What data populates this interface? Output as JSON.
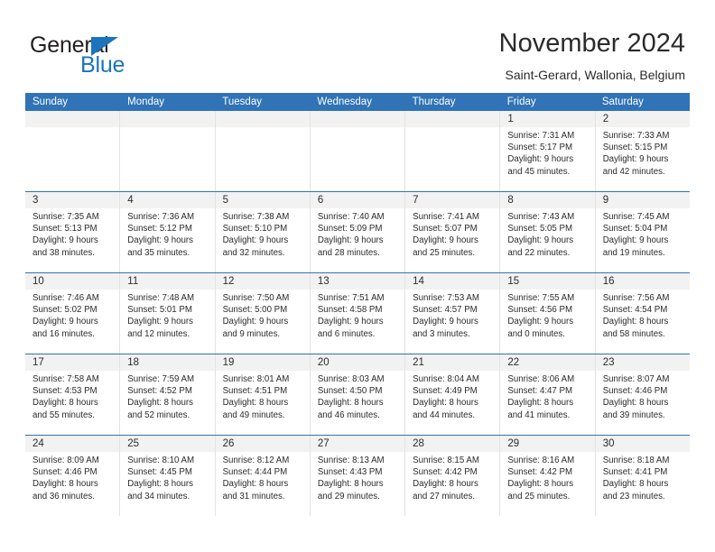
{
  "brand": {
    "name_top": "General",
    "name_bottom": "Blue",
    "accent_color": "#1b74bc"
  },
  "header": {
    "title": "November 2024",
    "subtitle": "Saint-Gerard, Wallonia, Belgium"
  },
  "theme": {
    "header_blue": "#3073b7",
    "day_band_gray": "#f2f2f2",
    "grid_line": "#e3e3e3"
  },
  "weekdays": [
    "Sunday",
    "Monday",
    "Tuesday",
    "Wednesday",
    "Thursday",
    "Friday",
    "Saturday"
  ],
  "weeks": [
    [
      {
        "day": "",
        "sunrise": "",
        "sunset": "",
        "daylight_1": "",
        "daylight_2": ""
      },
      {
        "day": "",
        "sunrise": "",
        "sunset": "",
        "daylight_1": "",
        "daylight_2": ""
      },
      {
        "day": "",
        "sunrise": "",
        "sunset": "",
        "daylight_1": "",
        "daylight_2": ""
      },
      {
        "day": "",
        "sunrise": "",
        "sunset": "",
        "daylight_1": "",
        "daylight_2": ""
      },
      {
        "day": "",
        "sunrise": "",
        "sunset": "",
        "daylight_1": "",
        "daylight_2": ""
      },
      {
        "day": "1",
        "sunrise": "Sunrise: 7:31 AM",
        "sunset": "Sunset: 5:17 PM",
        "daylight_1": "Daylight: 9 hours",
        "daylight_2": "and 45 minutes."
      },
      {
        "day": "2",
        "sunrise": "Sunrise: 7:33 AM",
        "sunset": "Sunset: 5:15 PM",
        "daylight_1": "Daylight: 9 hours",
        "daylight_2": "and 42 minutes."
      }
    ],
    [
      {
        "day": "3",
        "sunrise": "Sunrise: 7:35 AM",
        "sunset": "Sunset: 5:13 PM",
        "daylight_1": "Daylight: 9 hours",
        "daylight_2": "and 38 minutes."
      },
      {
        "day": "4",
        "sunrise": "Sunrise: 7:36 AM",
        "sunset": "Sunset: 5:12 PM",
        "daylight_1": "Daylight: 9 hours",
        "daylight_2": "and 35 minutes."
      },
      {
        "day": "5",
        "sunrise": "Sunrise: 7:38 AM",
        "sunset": "Sunset: 5:10 PM",
        "daylight_1": "Daylight: 9 hours",
        "daylight_2": "and 32 minutes."
      },
      {
        "day": "6",
        "sunrise": "Sunrise: 7:40 AM",
        "sunset": "Sunset: 5:09 PM",
        "daylight_1": "Daylight: 9 hours",
        "daylight_2": "and 28 minutes."
      },
      {
        "day": "7",
        "sunrise": "Sunrise: 7:41 AM",
        "sunset": "Sunset: 5:07 PM",
        "daylight_1": "Daylight: 9 hours",
        "daylight_2": "and 25 minutes."
      },
      {
        "day": "8",
        "sunrise": "Sunrise: 7:43 AM",
        "sunset": "Sunset: 5:05 PM",
        "daylight_1": "Daylight: 9 hours",
        "daylight_2": "and 22 minutes."
      },
      {
        "day": "9",
        "sunrise": "Sunrise: 7:45 AM",
        "sunset": "Sunset: 5:04 PM",
        "daylight_1": "Daylight: 9 hours",
        "daylight_2": "and 19 minutes."
      }
    ],
    [
      {
        "day": "10",
        "sunrise": "Sunrise: 7:46 AM",
        "sunset": "Sunset: 5:02 PM",
        "daylight_1": "Daylight: 9 hours",
        "daylight_2": "and 16 minutes."
      },
      {
        "day": "11",
        "sunrise": "Sunrise: 7:48 AM",
        "sunset": "Sunset: 5:01 PM",
        "daylight_1": "Daylight: 9 hours",
        "daylight_2": "and 12 minutes."
      },
      {
        "day": "12",
        "sunrise": "Sunrise: 7:50 AM",
        "sunset": "Sunset: 5:00 PM",
        "daylight_1": "Daylight: 9 hours",
        "daylight_2": "and 9 minutes."
      },
      {
        "day": "13",
        "sunrise": "Sunrise: 7:51 AM",
        "sunset": "Sunset: 4:58 PM",
        "daylight_1": "Daylight: 9 hours",
        "daylight_2": "and 6 minutes."
      },
      {
        "day": "14",
        "sunrise": "Sunrise: 7:53 AM",
        "sunset": "Sunset: 4:57 PM",
        "daylight_1": "Daylight: 9 hours",
        "daylight_2": "and 3 minutes."
      },
      {
        "day": "15",
        "sunrise": "Sunrise: 7:55 AM",
        "sunset": "Sunset: 4:56 PM",
        "daylight_1": "Daylight: 9 hours",
        "daylight_2": "and 0 minutes."
      },
      {
        "day": "16",
        "sunrise": "Sunrise: 7:56 AM",
        "sunset": "Sunset: 4:54 PM",
        "daylight_1": "Daylight: 8 hours",
        "daylight_2": "and 58 minutes."
      }
    ],
    [
      {
        "day": "17",
        "sunrise": "Sunrise: 7:58 AM",
        "sunset": "Sunset: 4:53 PM",
        "daylight_1": "Daylight: 8 hours",
        "daylight_2": "and 55 minutes."
      },
      {
        "day": "18",
        "sunrise": "Sunrise: 7:59 AM",
        "sunset": "Sunset: 4:52 PM",
        "daylight_1": "Daylight: 8 hours",
        "daylight_2": "and 52 minutes."
      },
      {
        "day": "19",
        "sunrise": "Sunrise: 8:01 AM",
        "sunset": "Sunset: 4:51 PM",
        "daylight_1": "Daylight: 8 hours",
        "daylight_2": "and 49 minutes."
      },
      {
        "day": "20",
        "sunrise": "Sunrise: 8:03 AM",
        "sunset": "Sunset: 4:50 PM",
        "daylight_1": "Daylight: 8 hours",
        "daylight_2": "and 46 minutes."
      },
      {
        "day": "21",
        "sunrise": "Sunrise: 8:04 AM",
        "sunset": "Sunset: 4:49 PM",
        "daylight_1": "Daylight: 8 hours",
        "daylight_2": "and 44 minutes."
      },
      {
        "day": "22",
        "sunrise": "Sunrise: 8:06 AM",
        "sunset": "Sunset: 4:47 PM",
        "daylight_1": "Daylight: 8 hours",
        "daylight_2": "and 41 minutes."
      },
      {
        "day": "23",
        "sunrise": "Sunrise: 8:07 AM",
        "sunset": "Sunset: 4:46 PM",
        "daylight_1": "Daylight: 8 hours",
        "daylight_2": "and 39 minutes."
      }
    ],
    [
      {
        "day": "24",
        "sunrise": "Sunrise: 8:09 AM",
        "sunset": "Sunset: 4:46 PM",
        "daylight_1": "Daylight: 8 hours",
        "daylight_2": "and 36 minutes."
      },
      {
        "day": "25",
        "sunrise": "Sunrise: 8:10 AM",
        "sunset": "Sunset: 4:45 PM",
        "daylight_1": "Daylight: 8 hours",
        "daylight_2": "and 34 minutes."
      },
      {
        "day": "26",
        "sunrise": "Sunrise: 8:12 AM",
        "sunset": "Sunset: 4:44 PM",
        "daylight_1": "Daylight: 8 hours",
        "daylight_2": "and 31 minutes."
      },
      {
        "day": "27",
        "sunrise": "Sunrise: 8:13 AM",
        "sunset": "Sunset: 4:43 PM",
        "daylight_1": "Daylight: 8 hours",
        "daylight_2": "and 29 minutes."
      },
      {
        "day": "28",
        "sunrise": "Sunrise: 8:15 AM",
        "sunset": "Sunset: 4:42 PM",
        "daylight_1": "Daylight: 8 hours",
        "daylight_2": "and 27 minutes."
      },
      {
        "day": "29",
        "sunrise": "Sunrise: 8:16 AM",
        "sunset": "Sunset: 4:42 PM",
        "daylight_1": "Daylight: 8 hours",
        "daylight_2": "and 25 minutes."
      },
      {
        "day": "30",
        "sunrise": "Sunrise: 8:18 AM",
        "sunset": "Sunset: 4:41 PM",
        "daylight_1": "Daylight: 8 hours",
        "daylight_2": "and 23 minutes."
      }
    ]
  ]
}
